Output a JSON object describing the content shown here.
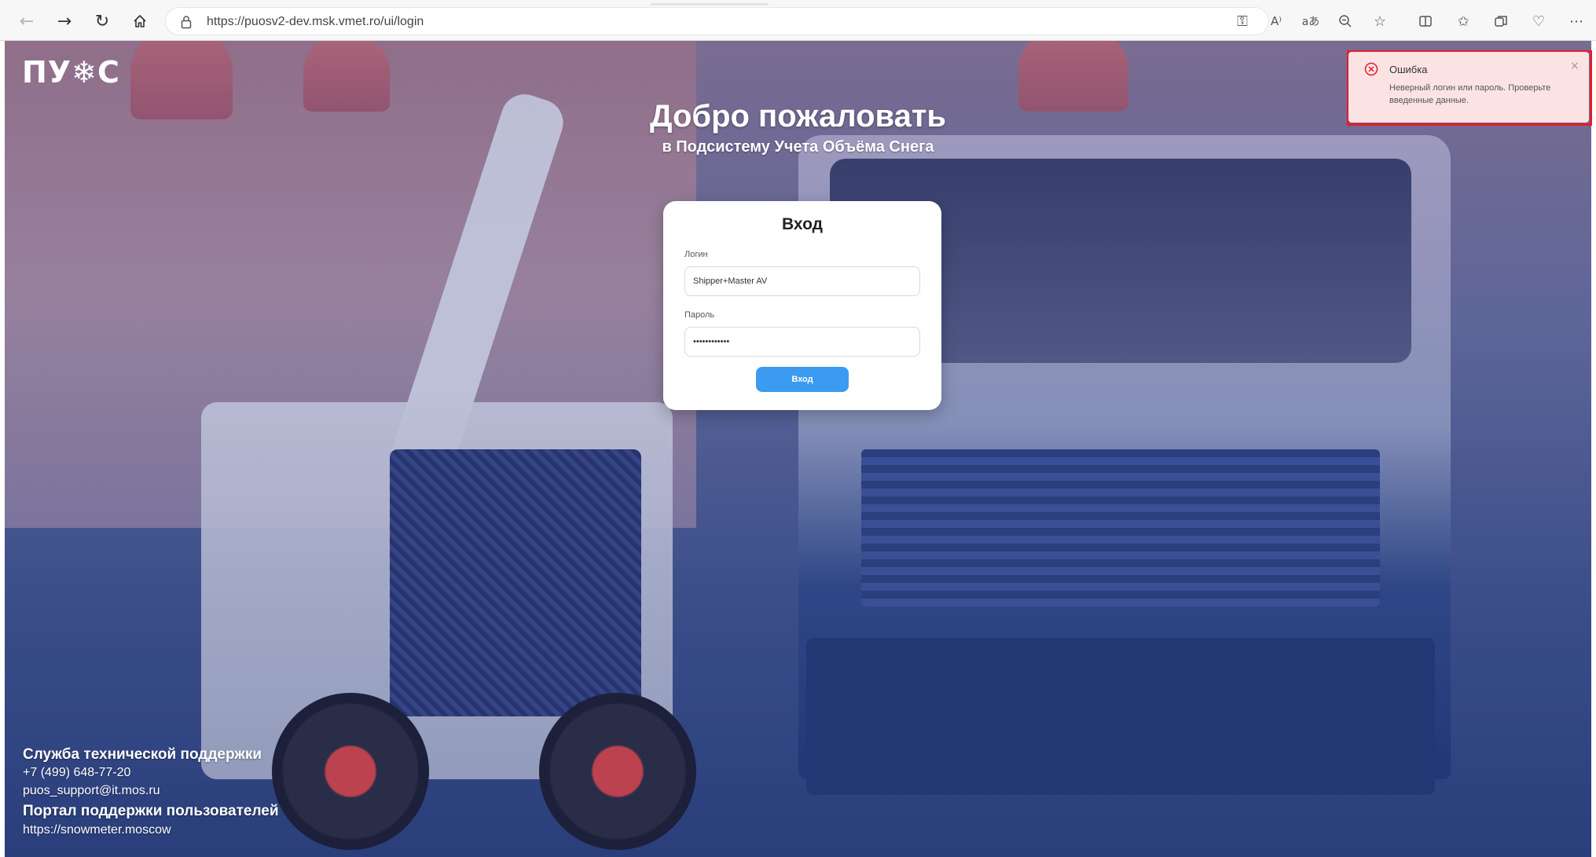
{
  "browser": {
    "url": "https://puosv2-dev.msk.vmet.ro/ui/login",
    "icons": {
      "back": "arrow-left-icon",
      "forward": "arrow-right-icon",
      "refresh": "refresh-icon",
      "home": "home-icon",
      "lock": "lock-icon",
      "key": "key-icon",
      "read_aloud": "read-aloud-icon",
      "translate": "translate-icon",
      "zoom_out": "zoom-out-icon",
      "favorite": "star-icon",
      "split_screen": "split-screen-icon",
      "favorites": "favorites-icon",
      "collections": "collections-icon",
      "health": "browser-essentials-icon",
      "more": "more-icon"
    }
  },
  "logo": {
    "text": "ПУ❄С"
  },
  "welcome": {
    "title": "Добро пожаловать",
    "subtitle": "в Подсистему Учета Объёма Снега"
  },
  "login_form": {
    "title": "Вход",
    "login_label": "Логин",
    "login_value": "Shipper+Master AV",
    "password_label": "Пароль",
    "password_value": "••••••••••••",
    "submit_label": "Вход",
    "accent_color": "#3a9bf0"
  },
  "error_toast": {
    "title": "Ошибка",
    "message": "Неверный логин или пароль. Проверьте введенные данные.",
    "close": "×",
    "icon": "error-circle-icon",
    "color": "#e41d2a"
  },
  "footer": {
    "support_title": "Служба технической поддержки",
    "phone": "+7 (499) 648-77-20",
    "email": "puos_support@it.mos.ru",
    "portal_title": "Портал поддержки пользователей",
    "portal_url": "https://snowmeter.moscow"
  }
}
